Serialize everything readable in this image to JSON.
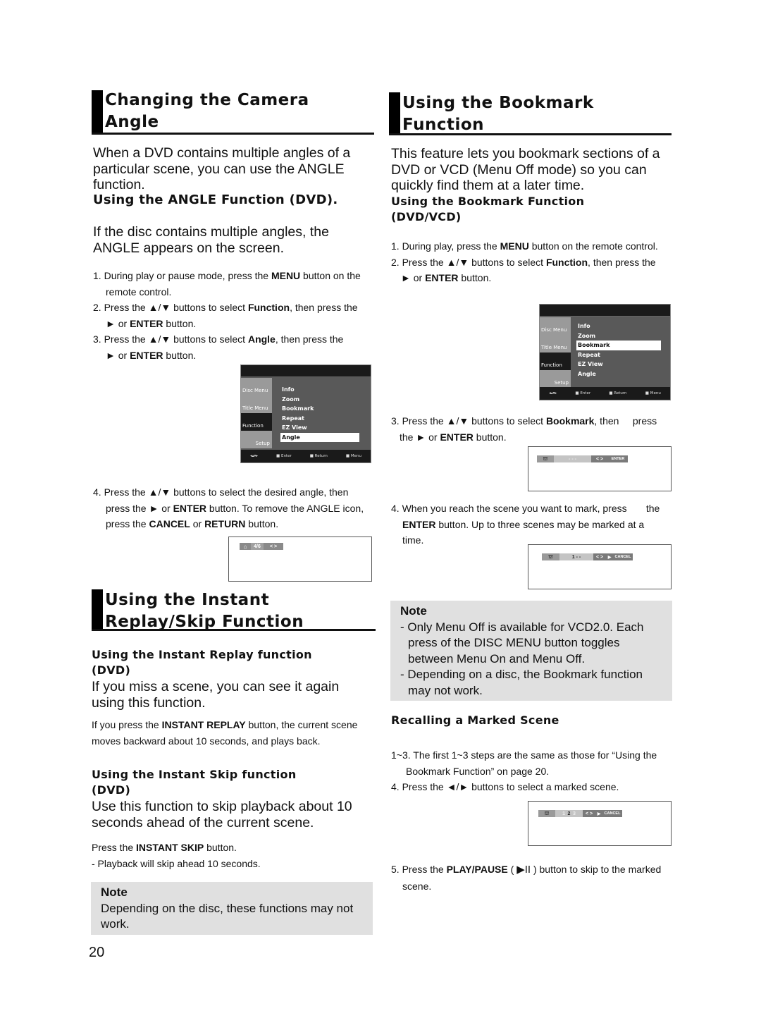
{
  "page_number": "20",
  "left": {
    "camera": {
      "title_line1": "Changing the Camera",
      "title_line2": "Angle",
      "intro": "When a DVD contains multiple angles of a particular scene, you can use the ANGLE function.",
      "subheading": "Using the ANGLE Function (DVD).",
      "sub_intro": "If the disc contains multiple angles, the ANGLE appears on the screen.",
      "steps": [
        {
          "num": "1.",
          "pre": "During play or pause mode, press the ",
          "bold": "MENU",
          "post": " button on the",
          "line2": "remote control."
        },
        {
          "num": "2.",
          "pre": "Press the ▲/▼ buttons to select ",
          "bold": "Function",
          "post": ", then press the",
          "line2_arrow": "► or ",
          "line2_bold": "ENTER",
          "line2_post": "  button."
        },
        {
          "num": "3.",
          "pre": "Press the ▲/▼ buttons to select ",
          "bold": "Angle",
          "post": ", then press the",
          "line2_arrow": "► or ",
          "line2_bold": "ENTER",
          "line2_post": " button."
        }
      ],
      "step4": {
        "num": "4.",
        "line1": "Press the ▲/▼ buttons to select the desired angle, then",
        "line2_pre": "press the ► or ",
        "line2_bold": "ENTER",
        "line2_post": " button. To remove the ANGLE icon,",
        "line3_pre": "press the ",
        "line3_bold1": "CANCEL",
        "line3_mid": " or  ",
        "line3_bold2": "RETURN",
        "line3_post": " button."
      },
      "menu": {
        "side": [
          "Disc Menu",
          "Title Menu",
          "Function",
          "Setup"
        ],
        "items": [
          "Info",
          "Zoom",
          "Bookmark",
          "Repeat",
          "EZ View",
          "Angle"
        ],
        "selected": "Angle",
        "footer": [
          "Enter",
          "Return",
          "Menu"
        ]
      },
      "angle_osd": {
        "value": "4/6",
        "arrows": "< >"
      }
    },
    "replay": {
      "title_line1": "Using the Instant",
      "title_line2": "Replay/Skip Function",
      "replay_heading_line1": "Using the Instant Replay function",
      "replay_heading_line2": "(DVD)",
      "replay_intro": "If you miss a scene, you can see it again using this function.",
      "replay_text_pre": "If you press the ",
      "replay_text_bold": "INSTANT REPLAY",
      "replay_text_post": " button, the current scene moves backward about 10 seconds, and plays back.",
      "skip_heading_line1": "Using the Instant Skip function",
      "skip_heading_line2": "(DVD)",
      "skip_intro": "Use this function to skip playback about 10 seconds ahead of the current scene.",
      "skip_text_pre": "Press the ",
      "skip_text_bold": "INSTANT SKIP",
      "skip_text_post": " button.",
      "skip_bullet": "- Playback will skip ahead 10 seconds.",
      "note_title": "Note",
      "note_text": "Depending on the disc, these functions may not work."
    }
  },
  "right": {
    "bookmark": {
      "title_line1": "Using the Bookmark",
      "title_line2": "Function",
      "intro": "This feature lets you bookmark sections of a DVD or VCD (Menu Off mode) so you can quickly find them at a later time.",
      "subheading_line1": "Using the Bookmark Function",
      "subheading_line2": "(DVD/VCD)",
      "step1_pre": "1. During play, press the ",
      "step1_bold": "MENU",
      "step1_post": " button on the remote control.",
      "step2_pre": "2. Press the ▲/▼ buttons to select ",
      "step2_bold": "Function",
      "step2_post": ", then press the",
      "step2_l2_pre": "► or ",
      "step2_l2_bold": "ENTER",
      "step2_l2_post": " button.",
      "menu": {
        "side": [
          "Disc Menu",
          "Title Menu",
          "Function",
          "Setup"
        ],
        "items": [
          "Info",
          "Zoom",
          "Bookmark",
          "Repeat",
          "EZ View",
          "Angle"
        ],
        "selected": "Bookmark",
        "footer": [
          "Enter",
          "Return",
          "Menu"
        ]
      },
      "step3_pre": "3. Press the ▲/▼ buttons to select ",
      "step3_bold": "Bookmark",
      "step3_post": ", then     press",
      "step3_l2_pre": "the ► or ",
      "step3_l2_bold": "ENTER",
      "step3_l2_post": " button.",
      "osd1": {
        "slots": "-  -  -",
        "arrows": "< >",
        "action": "ENTER"
      },
      "step4_l1": "4. When you reach the scene you want to mark, press       the",
      "step4_l2_bold": "ENTER",
      "step4_l2_post": " button. Up to three scenes may be marked at a",
      "step4_l3": "time.",
      "osd2": {
        "slots": "1  -  -",
        "arrows": "< >",
        "action": "CANCEL"
      },
      "note_title": "Note",
      "note_items": [
        "- Only Menu Off is available for VCD2.0. Each press of the DISC MENU button toggles between Menu On and Menu Off.",
        "- Depending on a disc, the Bookmark function may not work."
      ]
    },
    "recall": {
      "heading": "Recalling a Marked Scene",
      "step13_l1": "1~3. The first 1~3 steps are the same as those for “Using the",
      "step13_l2": "Bookmark Function” on page 20.",
      "step4": "4.  Press the ◄/► buttons to select a marked scene.",
      "osd3": {
        "slot1": "1",
        "slot2": "2",
        "slot3": "3",
        "arrows": "< >",
        "action": "CANCEL"
      },
      "step5_pre": "5. Press the ",
      "step5_bold": "PLAY/PAUSE",
      "step5_mid": " ( ",
      "step5_icon": "▶II",
      "step5_post": " ) button to skip to the marked",
      "step5_l2": "scene."
    }
  }
}
